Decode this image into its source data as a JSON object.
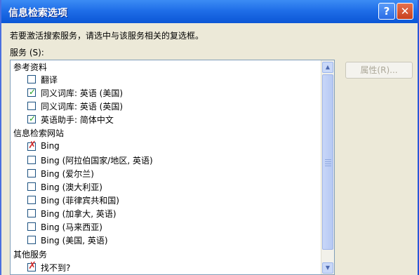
{
  "window": {
    "title": "信息检索选项",
    "help_glyph": "?",
    "close_glyph": "✕"
  },
  "prompt": "若要激活搜索服务，请选中与该服务相关的复选框。",
  "services_label": "服务 (S):",
  "properties_button": "属性(R)...",
  "groups": [
    {
      "title": "参考资料",
      "items": [
        {
          "label": "翻译",
          "state": "unchecked"
        },
        {
          "label": "同义词库: 英语 (美国)",
          "state": "checked"
        },
        {
          "label": "同义词库: 英语 (英国)",
          "state": "unchecked"
        },
        {
          "label": "英语助手: 简体中文",
          "state": "checked"
        }
      ]
    },
    {
      "title": "信息检索网站",
      "items": [
        {
          "label": "Bing",
          "state": "blocked"
        },
        {
          "label": "Bing (阿拉伯国家/地区, 英语)",
          "state": "unchecked"
        },
        {
          "label": "Bing (爱尔兰)",
          "state": "unchecked"
        },
        {
          "label": "Bing (澳大利亚)",
          "state": "unchecked"
        },
        {
          "label": "Bing (菲律宾共和国)",
          "state": "unchecked"
        },
        {
          "label": "Bing (加拿大, 英语)",
          "state": "unchecked"
        },
        {
          "label": "Bing (马来西亚)",
          "state": "unchecked"
        },
        {
          "label": "Bing (美国, 英语)",
          "state": "unchecked"
        }
      ]
    },
    {
      "title": "其他服务",
      "items": [
        {
          "label": "找不到?",
          "state": "blocked"
        }
      ]
    }
  ],
  "scrollbar": {
    "up_glyph": "▲",
    "down_glyph": "▼"
  },
  "marks": {
    "checked": "✓",
    "blocked": "✗"
  }
}
